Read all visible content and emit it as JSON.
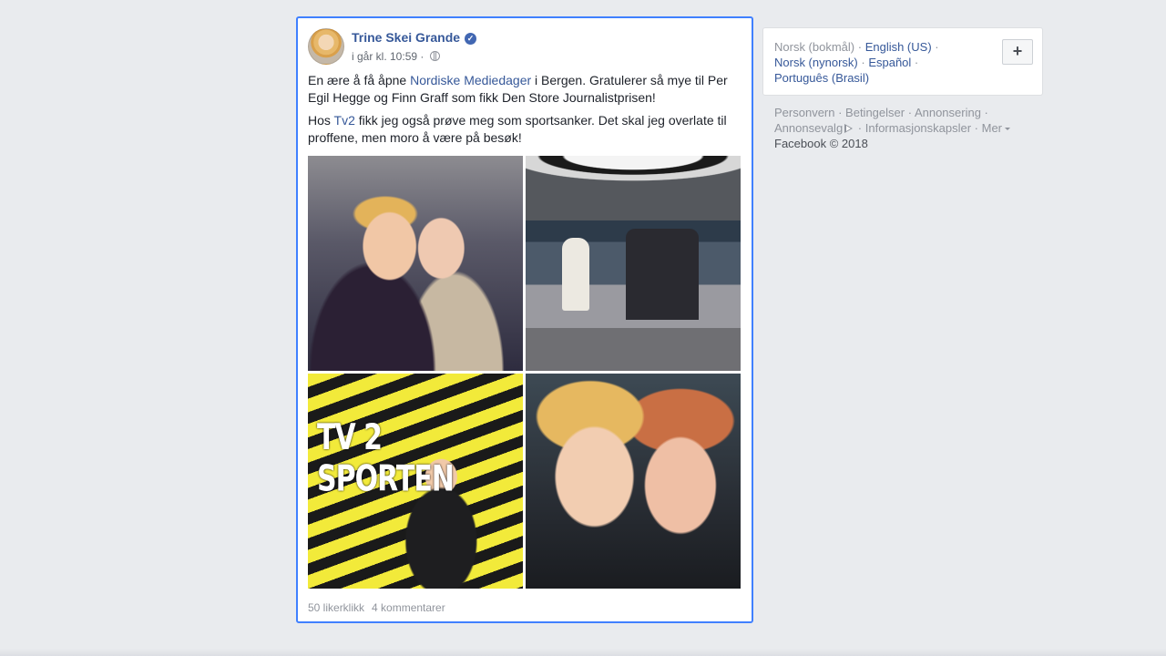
{
  "post": {
    "author": "Trine Skei Grande",
    "timestamp": "i går kl. 10:59 ·",
    "paragraph1": {
      "before": "En ære å få åpne ",
      "link": "Nordiske Mediedager",
      "after": " i Bergen. Gratulerer så mye til Per Egil Hegge og Finn Graff som fikk Den Store Journalistprisen!"
    },
    "paragraph2": {
      "before": "Hos ",
      "link": "Tv2",
      "after": " fikk jeg også prøve meg som sportsanker. Det skal jeg overlate til proffene, men moro å være på besøk!"
    },
    "photo3_sign": "TV 2 SPORTEN",
    "likes": "50 likerklikk",
    "comments": "4 kommentarer"
  },
  "languages": {
    "current": "Norsk (bokmål)",
    "links": [
      "English (US)",
      "Norsk (nynorsk)",
      "Español",
      "Português (Brasil)"
    ],
    "add_label": "+"
  },
  "footer": {
    "links": [
      "Personvern",
      "Betingelser",
      "Annonsering",
      "Annonsevalg",
      "Informasjonskapsler",
      "Mer"
    ],
    "copyright": "Facebook © 2018"
  },
  "colors": {
    "background": "#e9ebee",
    "link": "#365899",
    "highlight_border": "#4080ff",
    "muted": "#90949c"
  }
}
